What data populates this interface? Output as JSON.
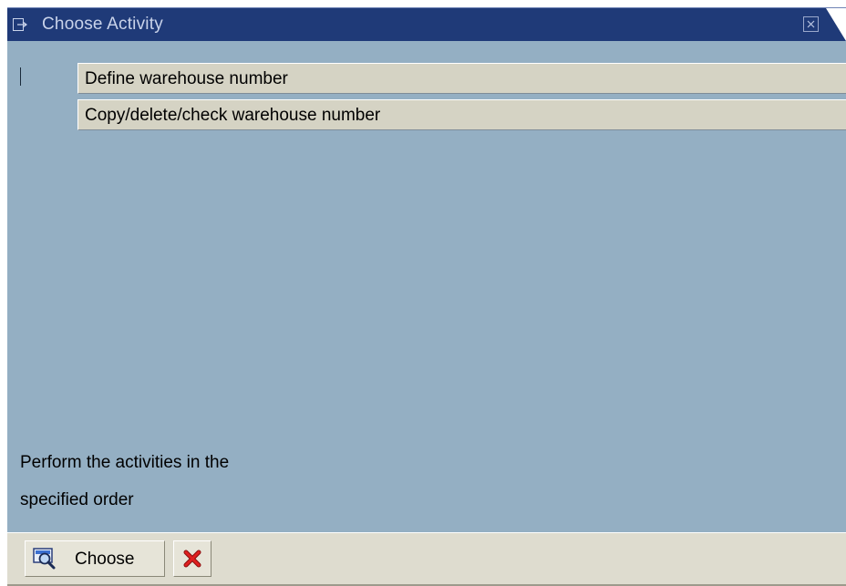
{
  "window": {
    "title": "Choose Activity",
    "title_icon": "dialog-icon",
    "close_icon": "close-icon",
    "colors": {
      "titlebar": "#1f3a78",
      "content": "#94afc3",
      "row": "#d5d3c4",
      "footer": "#dedccf"
    }
  },
  "activities": [
    {
      "label": "Define warehouse number"
    },
    {
      "label": "Copy/delete/check warehouse number"
    }
  ],
  "info": {
    "line1": "Perform the activities in the",
    "line2": "specified order"
  },
  "footer": {
    "choose_label": "Choose",
    "choose_icon": "choose-magnifier-icon",
    "cancel_icon": "cancel-x-icon"
  }
}
